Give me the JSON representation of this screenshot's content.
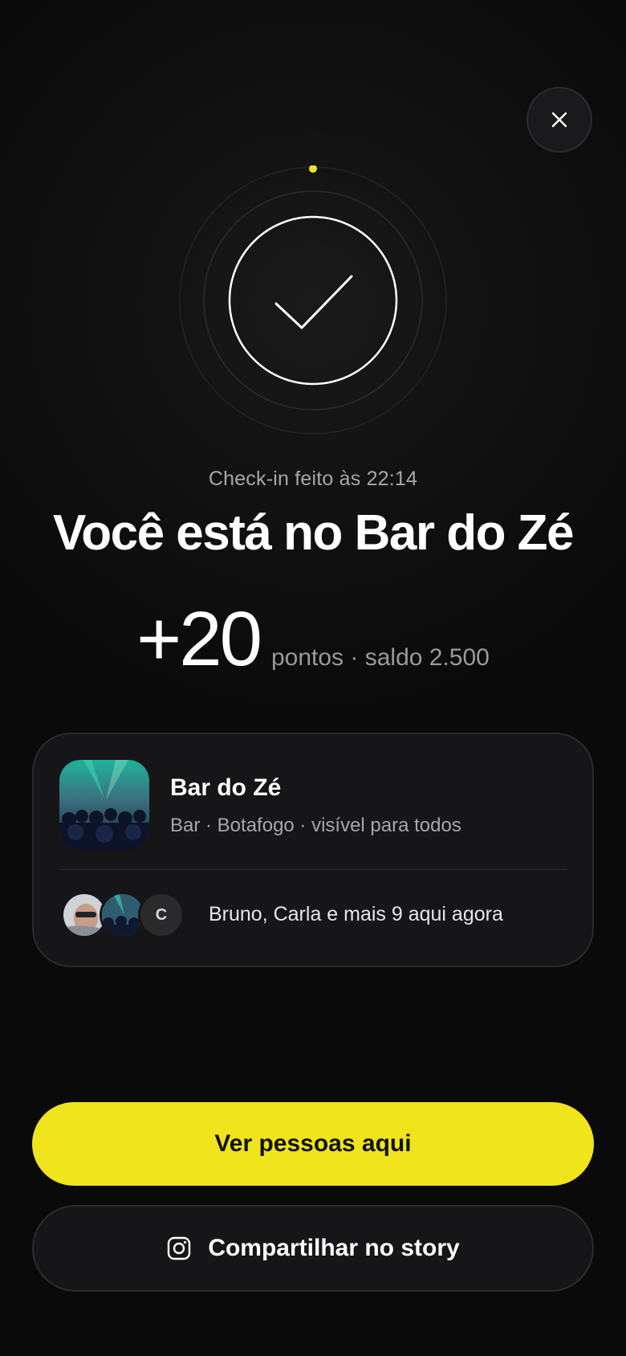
{
  "header": {
    "close_icon": "close-icon"
  },
  "status": {
    "icon": "check-icon",
    "accent_color": "#f0e41c",
    "checkin_text": "Check-in feito às 22:14",
    "title": "Você está no Bar do Zé"
  },
  "points": {
    "value": "+20",
    "suffix": "pontos · saldo 2.500"
  },
  "venue": {
    "name": "Bar do Zé",
    "meta": "Bar · Botafogo · visível para todos",
    "thumbnail": "venue-crowd-image",
    "avatars": [
      {
        "type": "photo",
        "icon": "person-photo"
      },
      {
        "type": "photo",
        "icon": "crowd-photo"
      },
      {
        "type": "initial",
        "initial": "C"
      }
    ],
    "people_text": "Bruno, Carla e mais 9 aqui agora"
  },
  "actions": {
    "primary_label": "Ver pessoas aqui",
    "primary_color": "#f0e41c",
    "secondary_label": "Compartilhar no story",
    "secondary_icon": "instagram-icon"
  }
}
